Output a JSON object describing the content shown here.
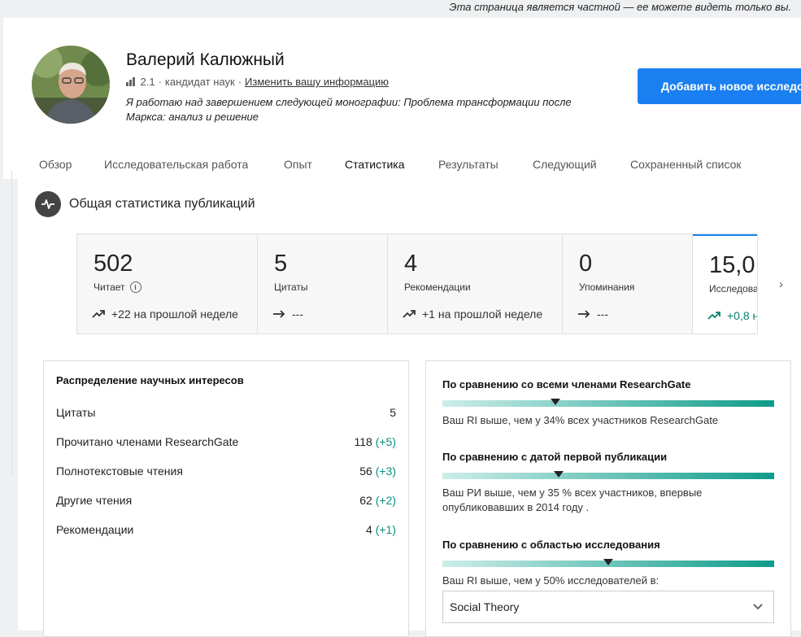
{
  "privacy_note": "Эта страница является частной — ее можете видеть только вы.",
  "profile": {
    "name": "Валерий Калюжный",
    "score": "2.1",
    "separator": "·",
    "degree": "кандидат наук",
    "edit_link": "Изменить вашу информацию",
    "bio": "Я работаю над завершением следующей монографии: Проблема трансформации после Маркса: анализ и решение",
    "add_button": "Добавить новое исследование"
  },
  "tabs": [
    {
      "label": "Обзор"
    },
    {
      "label": "Исследовательская работа"
    },
    {
      "label": "Опыт"
    },
    {
      "label": "Статистика",
      "active": true
    },
    {
      "label": "Результаты"
    },
    {
      "label": "Следующий"
    },
    {
      "label": "Сохраненный список"
    }
  ],
  "section_title": "Общая статистика публикаций",
  "stats": [
    {
      "value": "502",
      "label": "Читает",
      "change": "+22 на прошлой неделе",
      "trend": "up"
    },
    {
      "value": "5",
      "label": "Цитаты",
      "change": "---",
      "trend": "flat"
    },
    {
      "value": "4",
      "label": "Рекомендации",
      "change": "+1 на прошлой неделе",
      "trend": "up"
    },
    {
      "value": "0",
      "label": "Упоминания",
      "change": "---",
      "trend": "flat"
    },
    {
      "value": "15,0",
      "label": "Исследова",
      "change": "+0,8 н",
      "trend": "up"
    }
  ],
  "interests": {
    "title": "Распределение научных интересов",
    "rows": [
      {
        "label": "Цитаты",
        "value": "5",
        "delta": ""
      },
      {
        "label": "Прочитано членами ResearchGate",
        "value": "118",
        "delta": "(+5)"
      },
      {
        "label": "Полнотекстовые чтения",
        "value": "56",
        "delta": "(+3)"
      },
      {
        "label": "Другие чтения",
        "value": "62",
        "delta": "(+2)"
      },
      {
        "label": "Рекомендации",
        "value": "4",
        "delta": "(+1)"
      }
    ]
  },
  "comparisons": [
    {
      "title": "По сравнению со всеми членами ResearchGate",
      "marker_fraction": 0.34,
      "text": "Ваш RI выше, чем у 34% всех участников ResearchGate"
    },
    {
      "title": "По сравнению с датой первой публикации",
      "marker_fraction": 0.35,
      "text": "Ваш РИ выше, чем у 35 % всех участников, впервые опубликовавших в 2014 году ."
    },
    {
      "title": "По сравнению с областью исследования",
      "marker_fraction": 0.5,
      "text": "Ваш RI выше, чем у 50% исследователей в:"
    }
  ],
  "field_select": {
    "value": "Social Theory"
  },
  "colors": {
    "accent": "#1a7ff0",
    "teal": "#0e9c8a"
  }
}
